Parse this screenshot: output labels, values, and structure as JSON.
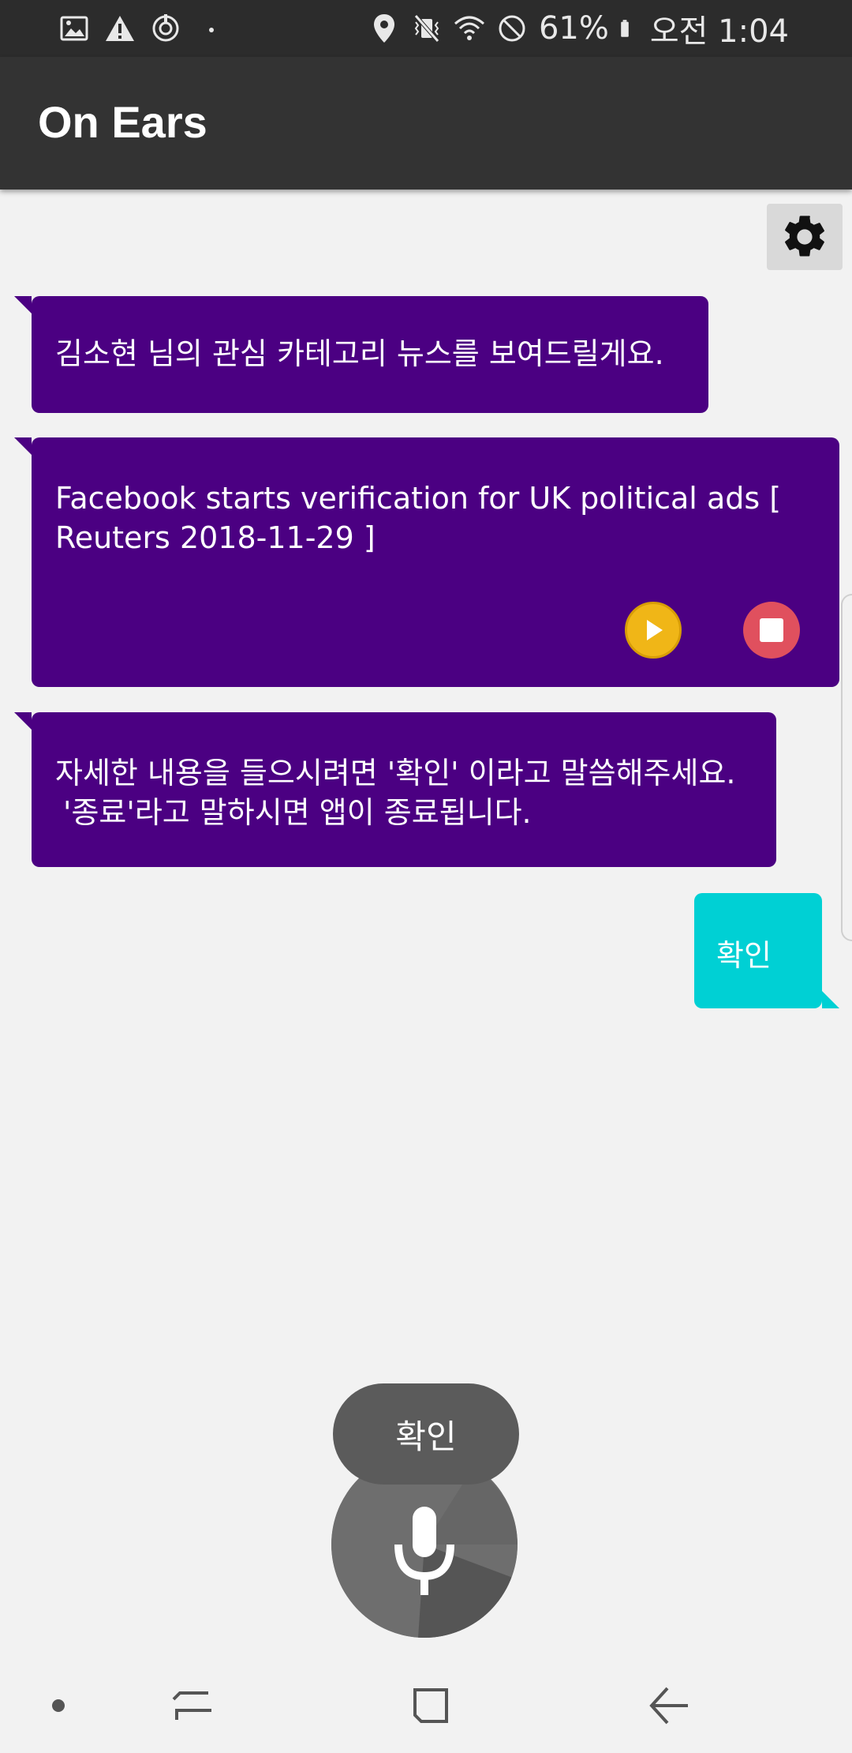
{
  "status_bar": {
    "battery": "61%",
    "time": "오전 1:04",
    "left_icons": [
      "image-icon",
      "warning-icon",
      "sync-icon",
      "dot-icon"
    ],
    "right_icons": [
      "location-icon",
      "vibrate-mute-icon",
      "wifi-icon",
      "do-not-disturb-icon",
      "battery-icon"
    ]
  },
  "app_bar": {
    "title": "On Ears"
  },
  "settings": {
    "icon": "gear-icon"
  },
  "messages": [
    {
      "from": "bot",
      "text": "김소현 님의 관심 카테고리 뉴스를 보여드릴게요."
    },
    {
      "from": "bot",
      "text": "Facebook starts verification for UK political ads [ Reuters 2018-11-29 ]",
      "controls": [
        "play-icon",
        "stop-icon"
      ]
    },
    {
      "from": "bot",
      "line1": "자세한 내용을 들으시려면 '확인' 이라고 말씀해주세요.",
      "line2": "'종료'라고 말하시면 앱이 종료됩니다."
    },
    {
      "from": "user",
      "text": "확인"
    }
  ],
  "voice": {
    "recognized": "확인",
    "icon": "microphone-icon"
  },
  "nav_bar": {
    "icons": [
      "dot-icon",
      "recent-apps-icon",
      "home-icon",
      "back-icon"
    ]
  },
  "colors": {
    "bot_bubble": "#4b0082",
    "user_bubble": "#00d0d4",
    "app_bar": "#333333",
    "play": "#f0b617",
    "stop": "#e0505e"
  }
}
